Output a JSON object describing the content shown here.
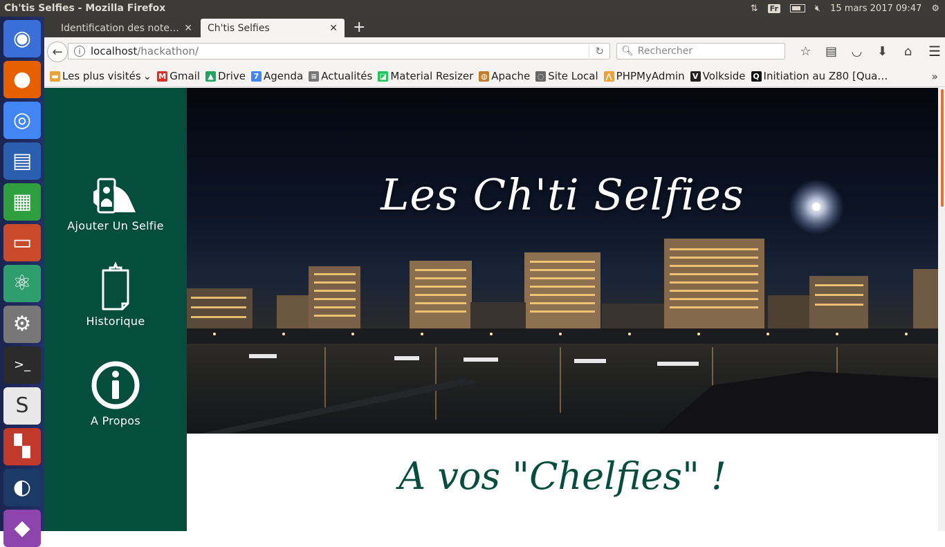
{
  "system": {
    "window_title": "Ch'tis Selfies - Mozilla Firefox",
    "keyboard_layout": "Fr",
    "datetime": "15 mars 2017 09:47"
  },
  "launcher": [
    {
      "name": "ubuntu-dash",
      "icon": "ubuntu-logo-icon",
      "color": "#3a6fd8"
    },
    {
      "name": "firefox",
      "icon": "firefox-icon",
      "color": "#e66000"
    },
    {
      "name": "chrome",
      "icon": "chrome-icon",
      "color": "#4285f4"
    },
    {
      "name": "libreoffice-writer",
      "icon": "document-icon",
      "color": "#2a5fb0"
    },
    {
      "name": "libreoffice-calc",
      "icon": "spreadsheet-icon",
      "color": "#2e9e3e"
    },
    {
      "name": "files",
      "icon": "file-cabinet-icon",
      "color": "#c94a2a"
    },
    {
      "name": "atom",
      "icon": "atom-icon",
      "color": "#2f9e6e"
    },
    {
      "name": "system-settings",
      "icon": "gear-wrench-icon",
      "color": "#777777"
    },
    {
      "name": "terminal",
      "icon": "terminal-icon",
      "color": "#2b2b2b"
    },
    {
      "name": "slack",
      "icon": "slack-icon",
      "color": "#e8e8e8"
    },
    {
      "name": "workspaces",
      "icon": "workspace-grid-icon",
      "color": "#c0392b"
    },
    {
      "name": "steam",
      "icon": "steam-icon",
      "color": "#1b3a66"
    },
    {
      "name": "unknown-app",
      "icon": "purple-app-icon",
      "color": "#8e44ad"
    }
  ],
  "browser": {
    "tabs": [
      {
        "label": "Identification des note…",
        "active": false
      },
      {
        "label": "Ch'tis Selfies",
        "active": true
      }
    ],
    "url_host": "localhost",
    "url_path": "/hackathon/",
    "search_placeholder": "Rechercher",
    "bookmarks": [
      {
        "label": "Les plus visités",
        "icon": "folder-icon",
        "color": "#e8a33b"
      },
      {
        "label": "Gmail",
        "icon": "gmail-icon",
        "color": "#d93025"
      },
      {
        "label": "Drive",
        "icon": "drive-icon",
        "color": "#1fa463"
      },
      {
        "label": "Agenda",
        "icon": "calendar-icon",
        "color": "#4285f4"
      },
      {
        "label": "Actualités",
        "icon": "news-icon",
        "color": "#777777"
      },
      {
        "label": "Material Resizer",
        "icon": "material-resizer-icon",
        "color": "#22c55e"
      },
      {
        "label": "Apache",
        "icon": "apache-icon",
        "color": "#c27c2a"
      },
      {
        "label": "Site Local",
        "icon": "globe-icon",
        "color": "#666666"
      },
      {
        "label": "PHPMyAdmin",
        "icon": "phpmyadmin-icon",
        "color": "#f0a030"
      },
      {
        "label": "Volkside",
        "icon": "volkside-icon",
        "color": "#222222"
      },
      {
        "label": "Initiation au Z80 [Qua…",
        "icon": "q-icon",
        "color": "#111111"
      }
    ]
  },
  "site": {
    "sidebar_bg": "#054e3d",
    "nav": [
      {
        "label": "Ajouter Un Selfie",
        "icon": "phone-selfie-icon"
      },
      {
        "label": "Historique",
        "icon": "clipboard-icon"
      },
      {
        "label": "A Propos",
        "icon": "info-icon"
      }
    ],
    "hero_title": "Les Ch'ti Selfies",
    "tagline": "A vos \"Chelfies\" !"
  }
}
